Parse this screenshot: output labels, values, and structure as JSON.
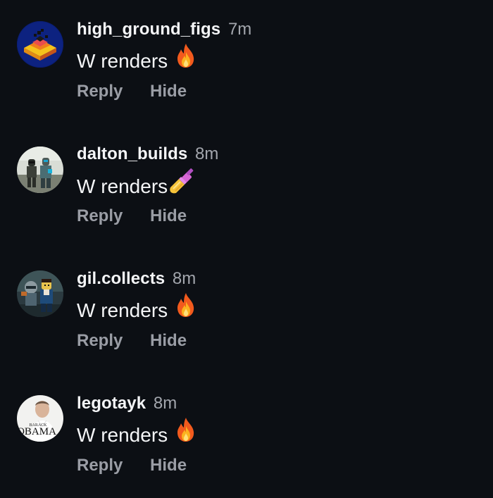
{
  "comments": [
    {
      "username": "high_ground_figs",
      "time": "7m",
      "text": "W renders",
      "emoji": "fire-emoji",
      "reply_label": "Reply",
      "hide_label": "Hide"
    },
    {
      "username": "dalton_builds",
      "time": "8m",
      "text": "W renders",
      "emoji": "nail-polish-emoji",
      "reply_label": "Reply",
      "hide_label": "Hide"
    },
    {
      "username": "gil.collects",
      "time": "8m",
      "text": "W renders",
      "emoji": "fire-emoji",
      "reply_label": "Reply",
      "hide_label": "Hide"
    },
    {
      "username": "legotayk",
      "time": "8m",
      "text": "W renders",
      "emoji": "fire-emoji",
      "reply_label": "Reply",
      "hide_label": "Hide",
      "avatar_text_small": "BARACK",
      "avatar_text_large": "OBAMA"
    }
  ],
  "colors": {
    "background": "#0c0f14",
    "username": "#f4f5f7",
    "time": "#a3a6ad",
    "action": "#9a9da5"
  }
}
